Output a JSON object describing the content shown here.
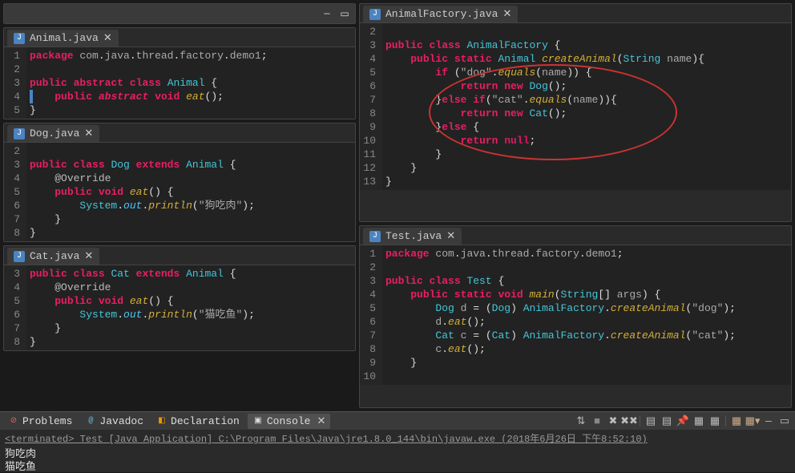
{
  "files": {
    "animal": {
      "name": "Animal.java",
      "lines": [
        {
          "n": 1,
          "tokens": [
            [
              "kw1",
              "package"
            ],
            [
              "pun",
              " "
            ],
            [
              "pkg",
              "com"
            ],
            [
              "pun",
              "."
            ],
            [
              "pkg",
              "java"
            ],
            [
              "pun",
              "."
            ],
            [
              "pkg",
              "thread"
            ],
            [
              "pun",
              "."
            ],
            [
              "pkg",
              "factory"
            ],
            [
              "pun",
              "."
            ],
            [
              "pkg",
              "demo1"
            ],
            [
              "pun",
              ";"
            ]
          ]
        },
        {
          "n": 2,
          "tokens": []
        },
        {
          "n": 3,
          "tokens": [
            [
              "kw1",
              "public"
            ],
            [
              "pun",
              " "
            ],
            [
              "kw1",
              "abstract"
            ],
            [
              "pun",
              " "
            ],
            [
              "kw1",
              "class"
            ],
            [
              "pun",
              " "
            ],
            [
              "cls",
              "Animal"
            ],
            [
              "pun",
              " {"
            ]
          ]
        },
        {
          "n": 4,
          "tokens": [
            [
              "pun",
              "    "
            ],
            [
              "kw1",
              "public"
            ],
            [
              "pun",
              " "
            ],
            [
              "kw2",
              "abstract"
            ],
            [
              "pun",
              " "
            ],
            [
              "kw1",
              "void"
            ],
            [
              "pun",
              " "
            ],
            [
              "mth",
              "eat"
            ],
            [
              "pun",
              "();"
            ]
          ],
          "bp": true,
          "marker": true
        },
        {
          "n": 5,
          "tokens": [
            [
              "pun",
              "}"
            ]
          ]
        }
      ]
    },
    "dog": {
      "name": "Dog.java",
      "lines": [
        {
          "n": 2,
          "tokens": []
        },
        {
          "n": 3,
          "tokens": [
            [
              "kw1",
              "public"
            ],
            [
              "pun",
              " "
            ],
            [
              "kw1",
              "class"
            ],
            [
              "pun",
              " "
            ],
            [
              "cls",
              "Dog"
            ],
            [
              "pun",
              " "
            ],
            [
              "kw1",
              "extends"
            ],
            [
              "pun",
              " "
            ],
            [
              "cls",
              "Animal"
            ],
            [
              "pun",
              " {"
            ]
          ]
        },
        {
          "n": 4,
          "tokens": [
            [
              "pun",
              "    "
            ],
            [
              "ann",
              "@Override"
            ]
          ],
          "bp": true
        },
        {
          "n": 5,
          "tokens": [
            [
              "pun",
              "    "
            ],
            [
              "kw1",
              "public"
            ],
            [
              "pun",
              " "
            ],
            [
              "kw1",
              "void"
            ],
            [
              "pun",
              " "
            ],
            [
              "mth",
              "eat"
            ],
            [
              "pun",
              "() {"
            ]
          ]
        },
        {
          "n": 6,
          "tokens": [
            [
              "pun",
              "        "
            ],
            [
              "cls",
              "System"
            ],
            [
              "pun",
              "."
            ],
            [
              "fld",
              "out"
            ],
            [
              "pun",
              "."
            ],
            [
              "mth",
              "println"
            ],
            [
              "pun",
              "("
            ],
            [
              "str",
              "\"狗吃肉\""
            ],
            [
              "pun",
              ");"
            ]
          ]
        },
        {
          "n": 7,
          "tokens": [
            [
              "pun",
              "    }"
            ]
          ]
        },
        {
          "n": 8,
          "tokens": [
            [
              "pun",
              "}"
            ]
          ]
        }
      ]
    },
    "cat": {
      "name": "Cat.java",
      "lines": [
        {
          "n": 3,
          "tokens": [
            [
              "kw1",
              "public"
            ],
            [
              "pun",
              " "
            ],
            [
              "kw1",
              "class"
            ],
            [
              "pun",
              " "
            ],
            [
              "cls",
              "Cat"
            ],
            [
              "pun",
              " "
            ],
            [
              "kw1",
              "extends"
            ],
            [
              "pun",
              " "
            ],
            [
              "cls",
              "Animal"
            ],
            [
              "pun",
              " {"
            ]
          ]
        },
        {
          "n": 4,
          "tokens": [
            [
              "pun",
              "    "
            ],
            [
              "ann",
              "@Override"
            ]
          ],
          "bp": true
        },
        {
          "n": 5,
          "tokens": [
            [
              "pun",
              "    "
            ],
            [
              "kw1",
              "public"
            ],
            [
              "pun",
              " "
            ],
            [
              "kw1",
              "void"
            ],
            [
              "pun",
              " "
            ],
            [
              "mth",
              "eat"
            ],
            [
              "pun",
              "() {"
            ]
          ]
        },
        {
          "n": 6,
          "tokens": [
            [
              "pun",
              "        "
            ],
            [
              "cls",
              "System"
            ],
            [
              "pun",
              "."
            ],
            [
              "fld",
              "out"
            ],
            [
              "pun",
              "."
            ],
            [
              "mth",
              "println"
            ],
            [
              "pun",
              "("
            ],
            [
              "str",
              "\"猫吃鱼\""
            ],
            [
              "pun",
              ");"
            ]
          ]
        },
        {
          "n": 7,
          "tokens": [
            [
              "pun",
              "    }"
            ]
          ]
        },
        {
          "n": 8,
          "tokens": [
            [
              "pun",
              "}"
            ]
          ]
        }
      ]
    },
    "factory": {
      "name": "AnimalFactory.java",
      "lines": [
        {
          "n": 2,
          "tokens": []
        },
        {
          "n": 3,
          "tokens": [
            [
              "kw1",
              "public"
            ],
            [
              "pun",
              " "
            ],
            [
              "kw1",
              "class"
            ],
            [
              "pun",
              " "
            ],
            [
              "cls",
              "AnimalFactory"
            ],
            [
              "pun",
              " {"
            ]
          ]
        },
        {
          "n": 4,
          "tokens": [
            [
              "pun",
              "    "
            ],
            [
              "kw1",
              "public"
            ],
            [
              "pun",
              " "
            ],
            [
              "kw1",
              "static"
            ],
            [
              "pun",
              " "
            ],
            [
              "cls",
              "Animal"
            ],
            [
              "pun",
              " "
            ],
            [
              "mth",
              "createAnimal"
            ],
            [
              "pun",
              "("
            ],
            [
              "cls",
              "String"
            ],
            [
              "pun",
              " "
            ],
            [
              "pkg",
              "name"
            ],
            [
              "pun",
              "){"
            ]
          ],
          "bp": true
        },
        {
          "n": 5,
          "tokens": [
            [
              "pun",
              "        "
            ],
            [
              "kw1",
              "if"
            ],
            [
              "pun",
              " ("
            ],
            [
              "str",
              "\"dog\""
            ],
            [
              "pun",
              "."
            ],
            [
              "mth",
              "equals"
            ],
            [
              "pun",
              "("
            ],
            [
              "pkg",
              "name"
            ],
            [
              "pun",
              ")) {"
            ]
          ]
        },
        {
          "n": 6,
          "tokens": [
            [
              "pun",
              "            "
            ],
            [
              "kw1",
              "return"
            ],
            [
              "pun",
              " "
            ],
            [
              "kw1",
              "new"
            ],
            [
              "pun",
              " "
            ],
            [
              "cls",
              "Dog"
            ],
            [
              "pun",
              "();"
            ]
          ]
        },
        {
          "n": 7,
          "tokens": [
            [
              "pun",
              "        }"
            ],
            [
              "kw1",
              "else"
            ],
            [
              "pun",
              " "
            ],
            [
              "kw1",
              "if"
            ],
            [
              "pun",
              "("
            ],
            [
              "str",
              "\"cat\""
            ],
            [
              "pun",
              "."
            ],
            [
              "mth",
              "equals"
            ],
            [
              "pun",
              "("
            ],
            [
              "pkg",
              "name"
            ],
            [
              "pun",
              ")){"
            ]
          ]
        },
        {
          "n": 8,
          "tokens": [
            [
              "pun",
              "            "
            ],
            [
              "kw1",
              "return"
            ],
            [
              "pun",
              " "
            ],
            [
              "kw1",
              "new"
            ],
            [
              "pun",
              " "
            ],
            [
              "cls",
              "Cat"
            ],
            [
              "pun",
              "();"
            ]
          ]
        },
        {
          "n": 9,
          "tokens": [
            [
              "pun",
              "        }"
            ],
            [
              "kw1",
              "else"
            ],
            [
              "pun",
              " {"
            ]
          ]
        },
        {
          "n": 10,
          "tokens": [
            [
              "pun",
              "            "
            ],
            [
              "kw1",
              "return"
            ],
            [
              "pun",
              " "
            ],
            [
              "kw3",
              "null"
            ],
            [
              "pun",
              ";"
            ]
          ]
        },
        {
          "n": 11,
          "tokens": [
            [
              "pun",
              "        }"
            ]
          ]
        },
        {
          "n": 12,
          "tokens": [
            [
              "pun",
              "    }"
            ]
          ]
        },
        {
          "n": 13,
          "tokens": [
            [
              "pun",
              "}"
            ]
          ]
        }
      ]
    },
    "test": {
      "name": "Test.java",
      "lines": [
        {
          "n": 1,
          "tokens": [
            [
              "kw1",
              "package"
            ],
            [
              "pun",
              " "
            ],
            [
              "pkg",
              "com"
            ],
            [
              "pun",
              "."
            ],
            [
              "pkg",
              "java"
            ],
            [
              "pun",
              "."
            ],
            [
              "pkg",
              "thread"
            ],
            [
              "pun",
              "."
            ],
            [
              "pkg",
              "factory"
            ],
            [
              "pun",
              "."
            ],
            [
              "pkg",
              "demo1"
            ],
            [
              "pun",
              ";"
            ]
          ]
        },
        {
          "n": 2,
          "tokens": []
        },
        {
          "n": 3,
          "tokens": [
            [
              "kw1",
              "public"
            ],
            [
              "pun",
              " "
            ],
            [
              "kw1",
              "class"
            ],
            [
              "pun",
              " "
            ],
            [
              "cls",
              "Test"
            ],
            [
              "pun",
              " {"
            ]
          ]
        },
        {
          "n": 4,
          "tokens": [
            [
              "pun",
              "    "
            ],
            [
              "kw1",
              "public"
            ],
            [
              "pun",
              " "
            ],
            [
              "kw1",
              "static"
            ],
            [
              "pun",
              " "
            ],
            [
              "kw1",
              "void"
            ],
            [
              "pun",
              " "
            ],
            [
              "mth",
              "main"
            ],
            [
              "pun",
              "("
            ],
            [
              "cls",
              "String"
            ],
            [
              "pun",
              "[] "
            ],
            [
              "pkg",
              "args"
            ],
            [
              "pun",
              ") {"
            ]
          ],
          "bp": true
        },
        {
          "n": 5,
          "tokens": [
            [
              "pun",
              "        "
            ],
            [
              "cls",
              "Dog"
            ],
            [
              "pun",
              " "
            ],
            [
              "pkg",
              "d"
            ],
            [
              "pun",
              " = ("
            ],
            [
              "cls",
              "Dog"
            ],
            [
              "pun",
              ") "
            ],
            [
              "cls",
              "AnimalFactory"
            ],
            [
              "pun",
              "."
            ],
            [
              "mth",
              "createAnimal"
            ],
            [
              "pun",
              "("
            ],
            [
              "str",
              "\"dog\""
            ],
            [
              "pun",
              ");"
            ]
          ]
        },
        {
          "n": 6,
          "tokens": [
            [
              "pun",
              "        "
            ],
            [
              "pkg",
              "d"
            ],
            [
              "pun",
              "."
            ],
            [
              "mth",
              "eat"
            ],
            [
              "pun",
              "();"
            ]
          ]
        },
        {
          "n": 7,
          "tokens": [
            [
              "pun",
              "        "
            ],
            [
              "cls",
              "Cat"
            ],
            [
              "pun",
              " "
            ],
            [
              "pkg",
              "c"
            ],
            [
              "pun",
              " = ("
            ],
            [
              "cls",
              "Cat"
            ],
            [
              "pun",
              ") "
            ],
            [
              "cls",
              "AnimalFactory"
            ],
            [
              "pun",
              "."
            ],
            [
              "mth",
              "createAnimal"
            ],
            [
              "pun",
              "("
            ],
            [
              "str",
              "\"cat\""
            ],
            [
              "pun",
              ");"
            ]
          ]
        },
        {
          "n": 8,
          "tokens": [
            [
              "pun",
              "        "
            ],
            [
              "pkg",
              "c"
            ],
            [
              "pun",
              "."
            ],
            [
              "mth",
              "eat"
            ],
            [
              "pun",
              "();"
            ]
          ]
        },
        {
          "n": 9,
          "tokens": [
            [
              "pun",
              "    }"
            ]
          ]
        },
        {
          "n": 10,
          "tokens": []
        }
      ]
    }
  },
  "bottomTabs": {
    "problems": "Problems",
    "javadoc": "Javadoc",
    "declaration": "Declaration",
    "console": "Console"
  },
  "console": {
    "terminated": "<terminated> Test [Java Application] C:\\Program Files\\Java\\jre1.8.0_144\\bin\\javaw.exe (2018年6月26日 下午8:52:10)",
    "out": [
      "狗吃肉",
      "猫吃鱼"
    ]
  }
}
